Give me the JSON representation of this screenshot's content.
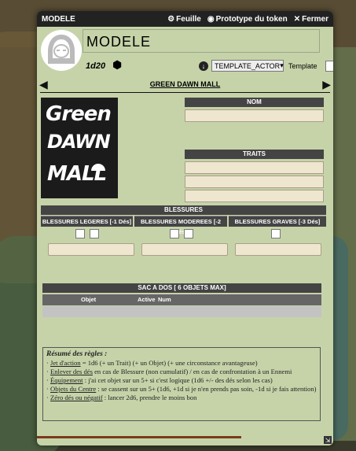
{
  "window": {
    "title": "MODELE",
    "buttons": [
      {
        "label": "Feuille",
        "icon": "gear-icon"
      },
      {
        "label": "Prototype du token",
        "icon": "user-circle-icon"
      },
      {
        "label": "Fermer",
        "icon": "close-icon"
      }
    ]
  },
  "header": {
    "name": "MODELE",
    "dice": "1d20",
    "actor_select": "TEMPLATE_ACTOR",
    "template_label": "Template",
    "template_checked": false
  },
  "nav": {
    "title": "GREEN DAWN MALL"
  },
  "logo": {
    "line1": "Green",
    "line2": "DAWN",
    "line3": "MALL"
  },
  "sections": {
    "nom": "NOM",
    "traits": "TRAITS",
    "blessures": "BLESSURES",
    "wounds": [
      {
        "label": "BLESSURES LEGERES [-1 Dés]",
        "checkboxes": 2
      },
      {
        "label": "BLESSURES MODEREES [-2 Dés]",
        "checkboxes": 2
      },
      {
        "label": "BLESSURES GRAVES [-3 Dés]",
        "checkboxes": 1
      }
    ],
    "sac": "SAC A DOS [ 6 OBJETS MAX]",
    "sac_columns": {
      "objet": "Objet",
      "active": "Active",
      "num": "Num"
    }
  },
  "rules": {
    "title": "Résumé des règles :",
    "lines": [
      {
        "term": "Jet d'action",
        "text": " = 1d6 (+ un Trait) (+ un Objet) (+ une circonstance avantageuse)"
      },
      {
        "term": "Enlever des dés",
        "text": " en cas de Blessure (non cumulatif) / en cas de confrontation à un Ennemi"
      },
      {
        "term": "Équipement",
        "text": " : j'ai cet objet sur un 5+ si c'est logique (1d6 +/- des dés selon les cas)"
      },
      {
        "term": "Objets du Centre",
        "text": " : se cassent sur un 5+ (1d6, +1d si je n'en prends pas soin, -1d si je fais attention)"
      },
      {
        "term": "Zéro dés ou négatif",
        "text": " : lancer 2d6, prendre le moins bon"
      }
    ]
  },
  "progress": 0.69,
  "colors": {
    "sheet_bg": "#c6d3a9",
    "header_dark": "#444444",
    "field_bg": "#efe6cf",
    "progress": "#7a3b1a"
  }
}
